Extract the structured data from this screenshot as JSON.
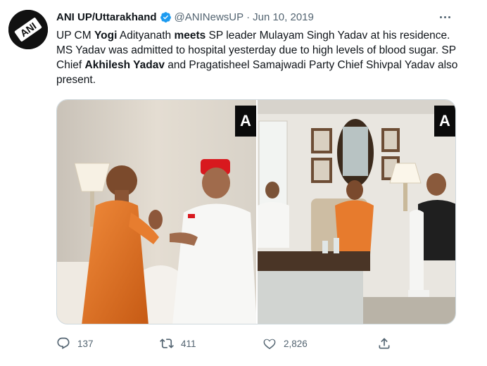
{
  "tweet": {
    "author_name": "ANI UP/Uttarakhand",
    "handle": "@ANINewsUP",
    "separator": "·",
    "date": "Jun 10, 2019",
    "avatar_text": "ANI",
    "text_segments": [
      {
        "t": "UP CM ",
        "bold": false
      },
      {
        "t": "Yogi",
        "bold": true
      },
      {
        "t": " Adityanath ",
        "bold": false
      },
      {
        "t": "meets",
        "bold": true
      },
      {
        "t": " SP leader Mulayam Singh Yadav at his residence. MS Yadav was admitted to hospital yesterday due to high levels of blood sugar. SP Chief ",
        "bold": false
      },
      {
        "t": "Akhilesh Yadav",
        "bold": true
      },
      {
        "t": " and Pragatisheel Samajwadi Party Chief Shivpal Yadav also present.",
        "bold": false
      }
    ],
    "watermark_left": "A",
    "watermark_right": "A"
  },
  "actions": {
    "reply_count": "137",
    "retweet_count": "411",
    "like_count": "2,826"
  },
  "colors": {
    "text": "#0f1419",
    "secondary": "#536471",
    "verified": "#1d9bf0",
    "border": "#cfd9de"
  },
  "icons": [
    "verified-badge-icon",
    "more-icon",
    "reply-icon",
    "retweet-icon",
    "like-icon",
    "share-icon"
  ]
}
